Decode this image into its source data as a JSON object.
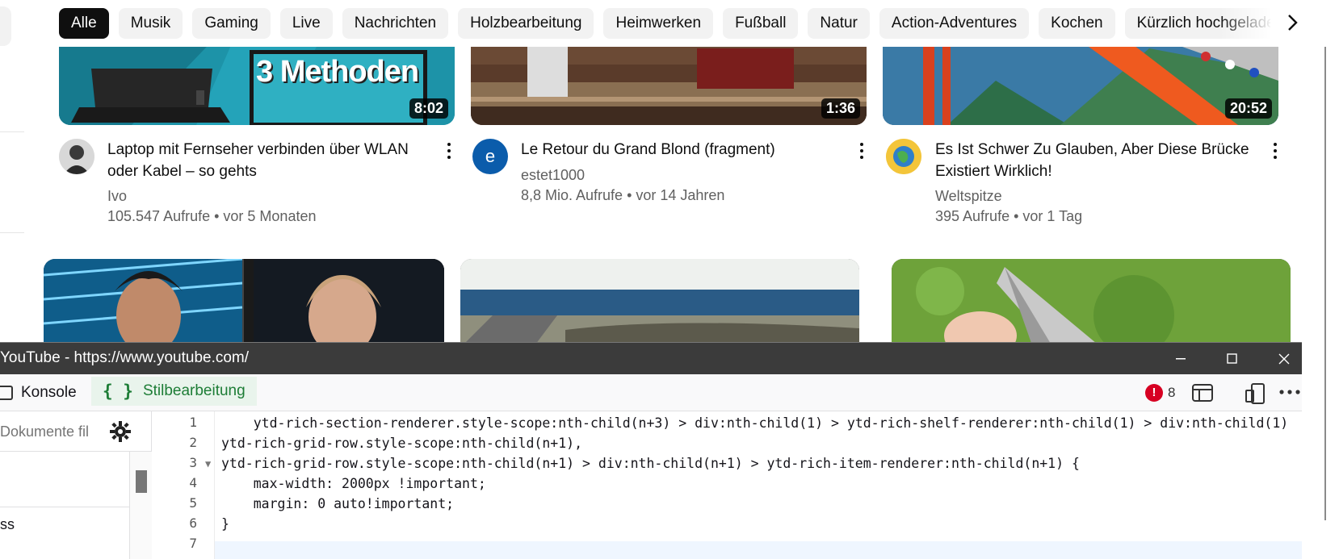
{
  "chips": [
    "Alle",
    "Musik",
    "Gaming",
    "Live",
    "Nachrichten",
    "Holzbearbeitung",
    "Heimwerken",
    "Fußball",
    "Natur",
    "Action-Adventures",
    "Kochen",
    "Kürzlich hochgeladen"
  ],
  "chip_next_icon": "chevron-right-icon",
  "videos": [
    {
      "title_line1": "Laptop mit Fernseher verbinden über WLAN",
      "title_line2": "oder Kabel – so gehts",
      "channel": "Ivo",
      "meta": "105.547 Aufrufe • vor 5 Monaten",
      "duration": "8:02",
      "thumb_text": "3 Methoden"
    },
    {
      "title_line1": "Le Retour du Grand Blond (fragment)",
      "title_line2": "",
      "channel": "estet1000",
      "meta": "8,8 Mio. Aufrufe • vor 14 Jahren",
      "duration": "1:36",
      "avatar_letter": "e"
    },
    {
      "title_line1": "Es Ist Schwer Zu Glauben, Aber Diese Brücke",
      "title_line2": "Existiert Wirklich!",
      "channel": "Weltspitze",
      "meta": "395 Aufrufe • vor 1 Tag",
      "duration": "20:52"
    }
  ],
  "devtools": {
    "title": "YouTube - https://www.youtube.com/",
    "tabs": {
      "console": "Konsole",
      "style": "Stilbearbeitung",
      "style_icon": "{ }"
    },
    "error_count": "8",
    "filter_placeholder": "Dokumente filtern",
    "left_item": "ss",
    "line_numbers": [
      "1",
      "2",
      "3",
      "4",
      "5",
      "6",
      "7"
    ],
    "code": {
      "l1": "    ytd-rich-section-renderer.style-scope:nth-child(n+3) > div:nth-child(1) > ytd-rich-shelf-renderer:nth-child(1) > div:nth-child(1)",
      "l2": "ytd-rich-grid-row.style-scope:nth-child(n+1),",
      "l3": "ytd-rich-grid-row.style-scope:nth-child(n+1) > div:nth-child(n+1) > ytd-rich-item-renderer:nth-child(n+1) {",
      "l4": "    max-width: 2000px !important;",
      "l5": "    margin: 0 auto!important;",
      "l6": "}"
    }
  }
}
